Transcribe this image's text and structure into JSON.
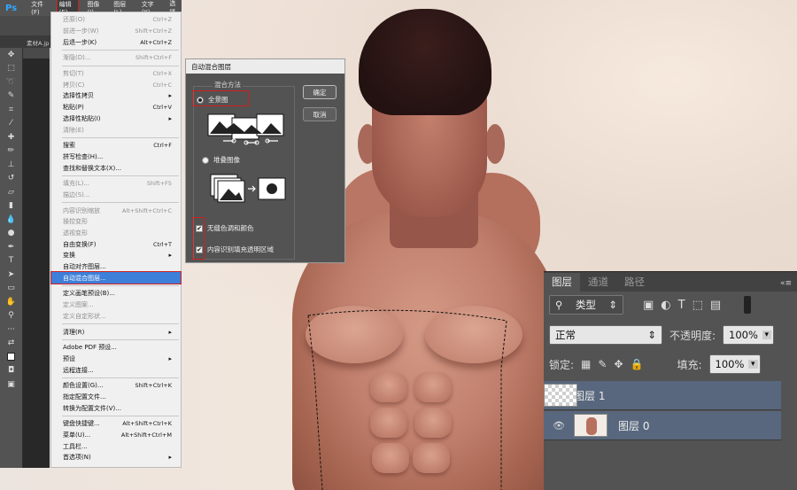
{
  "app": {
    "logo": "Ps"
  },
  "menubar": [
    "文件(F)",
    "编辑(E)",
    "图像(I)",
    "图层(L)",
    "文字(Y)",
    "选择"
  ],
  "doc_tab": "素材A.jp",
  "edit_menu": [
    {
      "label": "还原(O)",
      "shortcut": "Ctrl+Z",
      "disabled": true
    },
    {
      "label": "前进一步(W)",
      "shortcut": "Shift+Ctrl+Z",
      "disabled": true
    },
    {
      "label": "后退一步(K)",
      "shortcut": "Alt+Ctrl+Z"
    },
    {
      "sep": true
    },
    {
      "label": "渐隐(D)...",
      "shortcut": "Shift+Ctrl+F",
      "disabled": true
    },
    {
      "sep": true
    },
    {
      "label": "剪切(T)",
      "shortcut": "Ctrl+X",
      "disabled": true
    },
    {
      "label": "拷贝(C)",
      "shortcut": "Ctrl+C",
      "disabled": true
    },
    {
      "label": "选择性拷贝",
      "arrow": true
    },
    {
      "label": "粘贴(P)",
      "shortcut": "Ctrl+V"
    },
    {
      "label": "选择性粘贴(I)",
      "arrow": true
    },
    {
      "label": "清除(E)",
      "disabled": true
    },
    {
      "sep": true
    },
    {
      "label": "搜索",
      "shortcut": "Ctrl+F"
    },
    {
      "label": "拼写检查(H)..."
    },
    {
      "label": "查找和替换文本(X)..."
    },
    {
      "sep": true
    },
    {
      "label": "填充(L)...",
      "shortcut": "Shift+F5",
      "disabled": true
    },
    {
      "label": "描边(S)...",
      "disabled": true
    },
    {
      "sep": true
    },
    {
      "label": "内容识别缩放",
      "shortcut": "Alt+Shift+Ctrl+C",
      "disabled": true
    },
    {
      "label": "操控变形",
      "disabled": true
    },
    {
      "label": "透视变形",
      "disabled": true
    },
    {
      "label": "自由变换(F)",
      "shortcut": "Ctrl+T"
    },
    {
      "label": "变换",
      "arrow": true
    },
    {
      "label": "自动对齐图层..."
    },
    {
      "label": "自动混合图层...",
      "highlight": true
    },
    {
      "sep": true
    },
    {
      "label": "定义画笔预设(B)..."
    },
    {
      "label": "定义图案...",
      "disabled": true
    },
    {
      "label": "定义自定形状...",
      "disabled": true
    },
    {
      "sep": true
    },
    {
      "label": "清理(R)",
      "arrow": true
    },
    {
      "sep": true
    },
    {
      "label": "Adobe PDF 预设..."
    },
    {
      "label": "预设",
      "arrow": true
    },
    {
      "label": "远程连接..."
    },
    {
      "sep": true
    },
    {
      "label": "颜色设置(G)...",
      "shortcut": "Shift+Ctrl+K"
    },
    {
      "label": "指定配置文件..."
    },
    {
      "label": "转换为配置文件(V)..."
    },
    {
      "sep": true
    },
    {
      "label": "键盘快捷键...",
      "shortcut": "Alt+Shift+Ctrl+K"
    },
    {
      "label": "菜单(U)...",
      "shortcut": "Alt+Shift+Ctrl+M"
    },
    {
      "label": "工具栏..."
    },
    {
      "label": "首选项(N)",
      "arrow": true
    }
  ],
  "dialog": {
    "title": "自动混合图层",
    "group_label": "混合方法",
    "option_panorama": "全景图",
    "option_stack": "堆叠图像",
    "check_seamless": "无缝色调和颜色",
    "check_content_aware": "内容识别填充透明区域",
    "ok": "确定",
    "cancel": "取消"
  },
  "layers_panel": {
    "tabs": [
      "图层",
      "通道",
      "路径"
    ],
    "filter_kind": "类型",
    "blend_mode": "正常",
    "opacity_label": "不透明度:",
    "opacity_value": "100%",
    "lock_label": "锁定:",
    "fill_label": "填充:",
    "fill_value": "100%",
    "layers": [
      {
        "name": "图层 1"
      },
      {
        "name": "图层 0"
      }
    ]
  },
  "colors": {
    "highlight": "#3d7fd9",
    "annotation_red": "#d01f1f",
    "panel_bg": "#535353",
    "layer_selected": "#58677d"
  }
}
